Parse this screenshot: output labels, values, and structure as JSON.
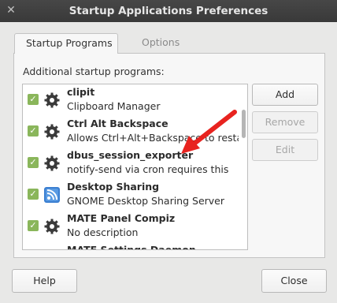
{
  "window": {
    "title": "Startup Applications Preferences",
    "close_glyph": "✕"
  },
  "tabs": [
    {
      "label": "Startup Programs",
      "active": true
    },
    {
      "label": "Options",
      "active": false
    }
  ],
  "panel": {
    "label": "Additional startup programs:"
  },
  "apps": [
    {
      "name": "clipit",
      "desc": "Clipboard Manager",
      "icon": "gear-icon",
      "checked": true
    },
    {
      "name": "Ctrl Alt Backspace",
      "desc": "Allows Ctrl+Alt+Backspace to restart...",
      "icon": "gear-icon",
      "checked": true
    },
    {
      "name": "dbus_session_exporter",
      "desc": "notify-send via cron requires this",
      "icon": "gear-icon",
      "checked": true
    },
    {
      "name": "Desktop Sharing",
      "desc": "GNOME Desktop Sharing Server",
      "icon": "desktop-sharing-icon",
      "checked": true
    },
    {
      "name": "MATE Panel Compiz",
      "desc": "No description",
      "icon": "gear-icon",
      "checked": true
    },
    {
      "name": "MATE Settings Daemon",
      "desc": "",
      "icon": "gear-icon",
      "checked": true
    }
  ],
  "side_buttons": {
    "add": "Add",
    "remove": "Remove",
    "edit": "Edit"
  },
  "footer": {
    "help": "Help",
    "close": "Close"
  },
  "colors": {
    "titlebar": "#3d3d3d",
    "checkbox": "#8ab65b",
    "arrow": "#e8231f",
    "share_icon": "#3b7fd1"
  }
}
